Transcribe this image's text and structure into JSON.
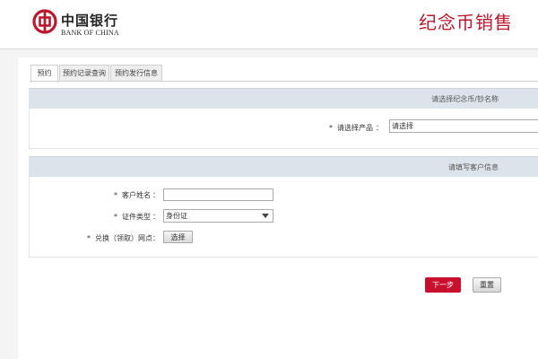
{
  "header": {
    "logo_cn": "中国银行",
    "logo_en": "BANK OF CHINA",
    "page_title": "纪念币销售"
  },
  "tabs": [
    {
      "label": "预约",
      "active": true
    },
    {
      "label": "预约记录查询",
      "active": false
    },
    {
      "label": "预约发行信息",
      "active": false
    }
  ],
  "product_section": {
    "title": "请选择纪念币/钞名称",
    "required_mark": "*",
    "product_label": "请选择产品",
    "colon": "：",
    "product_value": "请选择"
  },
  "customer_section": {
    "title": "请填写客户信息",
    "required_mark": "*",
    "colon": "：",
    "name_label": "客户姓名",
    "name_value": "",
    "id_type_label": "证件类型",
    "id_type_value": "身份证",
    "outlet_label": "兑换（领取）网点",
    "outlet_button": "选择"
  },
  "actions": {
    "next_label": "下一步",
    "reset_label": "重置"
  },
  "colors": {
    "brand_red": "#b8192e",
    "button_red": "#c8102e",
    "section_header_bg": "#dde3ea"
  },
  "icons": {
    "logo": "bank-of-china-logo-icon",
    "select_arrow": "chevron-down-icon"
  }
}
